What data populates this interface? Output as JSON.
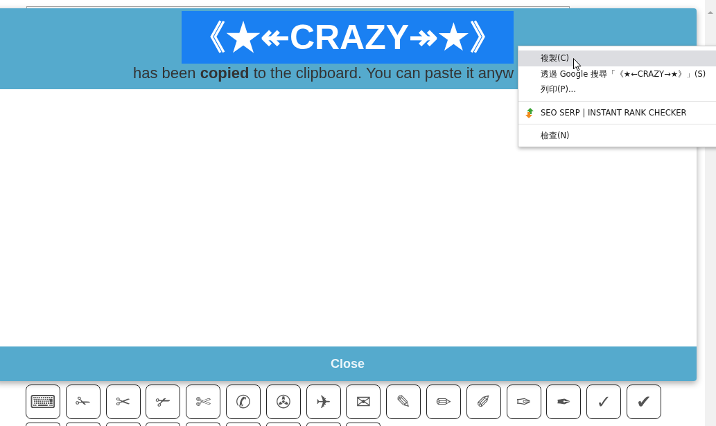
{
  "dialog": {
    "copied_text": {
      "text": "《★↞CRAZY↠★》",
      "highlighted": true
    },
    "message": "has been **copied** to the clipboard. You can paste it anyw",
    "close_button": "Close"
  },
  "symbols": [
    {
      "kind": "full",
      "char": "⌨"
    },
    {
      "kind": "full",
      "char": "✁"
    },
    {
      "kind": "full",
      "char": "✂"
    },
    {
      "kind": "full",
      "char": "✃"
    },
    {
      "kind": "full",
      "char": "✄"
    },
    {
      "kind": "full",
      "char": "✆"
    },
    {
      "kind": "full",
      "char": "✇"
    },
    {
      "kind": "full",
      "char": "✈"
    },
    {
      "kind": "full",
      "char": "✉"
    },
    {
      "kind": "full",
      "char": "✎"
    },
    {
      "kind": "full",
      "char": "✏"
    },
    {
      "kind": "full",
      "char": "✐"
    },
    {
      "kind": "full",
      "char": "✑"
    },
    {
      "kind": "full",
      "char": "✒"
    },
    {
      "kind": "full",
      "char": "✓"
    },
    {
      "kind": "full",
      "char": "✔"
    },
    {
      "kind": "cut_off"
    },
    {
      "kind": "cut_off"
    },
    {
      "kind": "cut_off"
    },
    {
      "kind": "cut_off"
    },
    {
      "kind": "cut_off"
    },
    {
      "kind": "cut_off"
    },
    {
      "kind": "cut_off"
    },
    {
      "kind": "cut_off"
    },
    {
      "kind": "cut_off"
    }
  ],
  "context_menu": {
    "groups": [
      [
        {
          "kind": "item",
          "label": "複製(C)",
          "highlighted": true
        },
        {
          "kind": "item",
          "label": "透過 Google 搜尋「《★←CRAZY→★》」(S)",
          "highlighted": false
        },
        {
          "kind": "item",
          "label": "列印(P)...",
          "highlighted": false
        }
      ],
      [
        {
          "kind": "extension",
          "label": "SEO SERP | INSTANT RANK CHECKER",
          "highlighted": false
        }
      ],
      [
        {
          "kind": "item",
          "label": "檢查(N)",
          "highlighted": false
        }
      ]
    ]
  }
}
